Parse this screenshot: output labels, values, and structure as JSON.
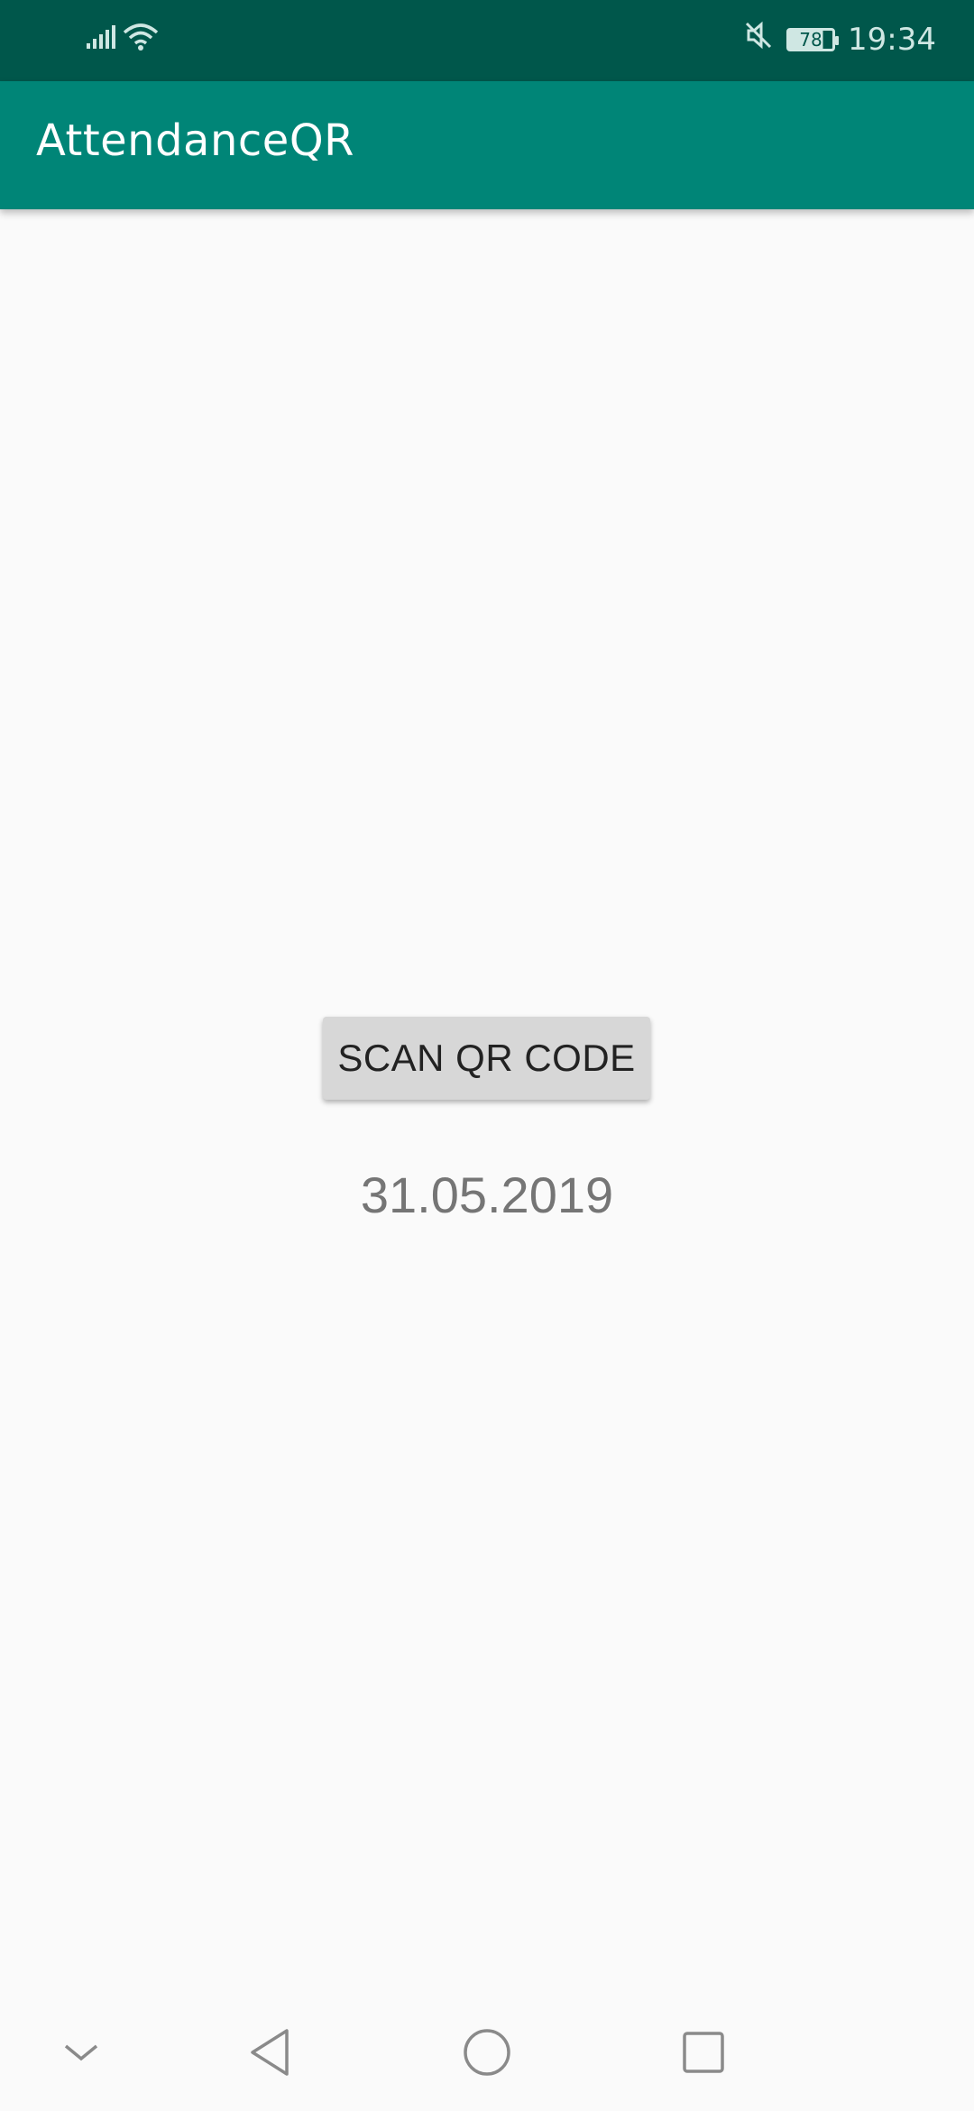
{
  "status_bar": {
    "battery_level": "78",
    "time": "19:34",
    "icons": [
      "signal-icon",
      "wifi-icon",
      "mute-icon",
      "battery-icon"
    ]
  },
  "app_bar": {
    "title": "AttendanceQR"
  },
  "main": {
    "scan_button_label": "SCAN QR CODE",
    "date": "31.05.2019"
  },
  "navigation": {
    "icons": [
      "collapse-icon",
      "back-icon",
      "home-icon",
      "recents-icon"
    ]
  },
  "colors": {
    "status_bar": "#00574b",
    "app_bar": "#008577",
    "background": "#fafafa",
    "button": "#d7d7d7"
  }
}
